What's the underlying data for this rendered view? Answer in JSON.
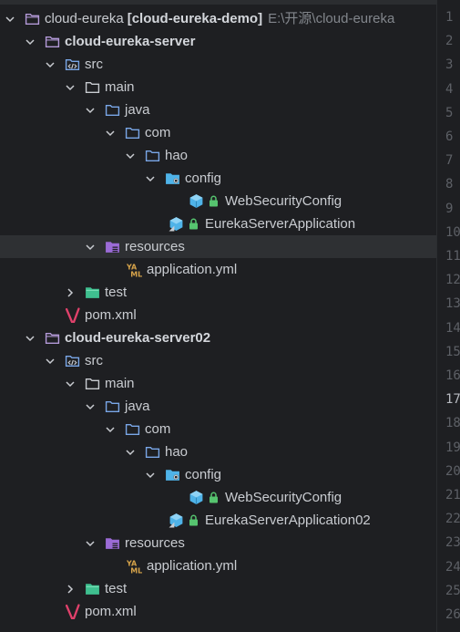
{
  "project": {
    "name": "cloud-eureka",
    "tag": "[cloud-eureka-demo]",
    "path": "E:\\开源\\cloud-eureka"
  },
  "modules": [
    {
      "name": "cloud-eureka-server",
      "src": "src",
      "main": "main",
      "java": "java",
      "com": "com",
      "hao": "hao",
      "config": "config",
      "security_class": "WebSecurityConfig",
      "app_class": "EurekaServerApplication",
      "resources": "resources",
      "yml": "application.yml",
      "test": "test",
      "pom": "pom.xml"
    },
    {
      "name": "cloud-eureka-server02",
      "src": "src",
      "main": "main",
      "java": "java",
      "com": "com",
      "hao": "hao",
      "config": "config",
      "security_class": "WebSecurityConfig",
      "app_class": "EurekaServerApplication02",
      "resources": "resources",
      "yml": "application.yml",
      "test": "test",
      "pom": "pom.xml"
    }
  ],
  "line_numbers": [
    "1",
    "2",
    "3",
    "4",
    "5",
    "6",
    "7",
    "8",
    "9",
    "10",
    "11",
    "12",
    "13",
    "14",
    "15",
    "16",
    "17",
    "18",
    "19",
    "20",
    "21",
    "22",
    "23",
    "24",
    "25",
    "26"
  ],
  "current_line": "17",
  "colors": {
    "background": "#1e1f22",
    "folder": "#7aa7e8",
    "module_folder": "#b49ad9",
    "resources": "#9b6bd6",
    "test_folder": "#3fbf8f",
    "java_class": "#4fb3e8",
    "lock": "#56c46f",
    "yaml": "#d7a44a",
    "maven": "#e0416b"
  }
}
